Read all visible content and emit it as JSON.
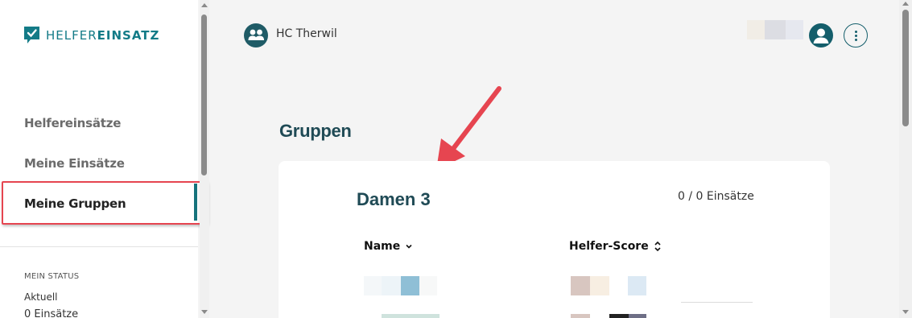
{
  "app": {
    "logo_light": "HELFER",
    "logo_bold": "EINSATZ",
    "brand_color": "#137b87"
  },
  "sidebar": {
    "items": [
      {
        "label": "Helfereinsätze"
      },
      {
        "label": "Meine Einsätze"
      },
      {
        "label": "Meine Gruppen",
        "active": true
      }
    ],
    "status": {
      "heading": "MEIN STATUS",
      "current": "Aktuell",
      "count": "0 Einsätze"
    }
  },
  "header": {
    "org_name": "HC Therwil",
    "org_icon": "group-icon",
    "user_icon": "user-icon",
    "menu_icon": "more-vertical-icon"
  },
  "main": {
    "title": "Gruppen",
    "group": {
      "name": "Damen 3",
      "assignments": "0 / 0 Einsätze",
      "columns": [
        {
          "label": "Name",
          "sort_icon": "chevron-down-icon"
        },
        {
          "label": "Helfer-Score",
          "sort_icon": "sort-updown-icon"
        }
      ]
    }
  },
  "annotation": {
    "highlight_color": "#e64550"
  }
}
